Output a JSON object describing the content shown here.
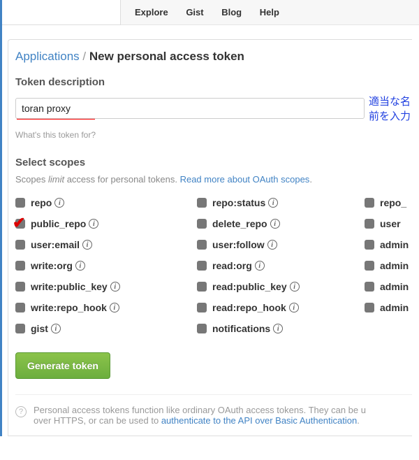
{
  "nav": {
    "explore": "Explore",
    "gist": "Gist",
    "blog": "Blog",
    "help": "Help"
  },
  "breadcrumb": {
    "parent": "Applications",
    "sep": "/",
    "current": "New personal access token"
  },
  "desc": {
    "label": "Token description",
    "value": "toran proxy",
    "jp_note": "適当な名前を入力",
    "hint": "What's this token for?"
  },
  "scopes_section": {
    "label": "Select scopes",
    "desc_pre": "Scopes ",
    "desc_em": "limit",
    "desc_post": " access for personal tokens. ",
    "link": "Read more about OAuth scopes",
    "link_dot": "."
  },
  "scopes": {
    "c0r0": "repo",
    "c1r0": "repo:status",
    "c2r0": "repo_",
    "c0r1": "public_repo",
    "c1r1": "delete_repo",
    "c2r1": "user",
    "c0r2": "user:email",
    "c1r2": "user:follow",
    "c2r2": "admin",
    "c0r3": "write:org",
    "c1r3": "read:org",
    "c2r3": "admin",
    "c0r4": "write:public_key",
    "c1r4": "read:public_key",
    "c2r4": "admin",
    "c0r5": "write:repo_hook",
    "c1r5": "read:repo_hook",
    "c2r5": "admin",
    "c0r6": "gist",
    "c1r6": "notifications"
  },
  "button": {
    "generate": "Generate token"
  },
  "footnote": {
    "text_pre": "Personal access tokens function like ordinary OAuth access tokens. They can be u",
    "text_mid": "over HTTPS, or can be used to ",
    "link": "authenticate to the API over Basic Authentication",
    "dot": "."
  }
}
